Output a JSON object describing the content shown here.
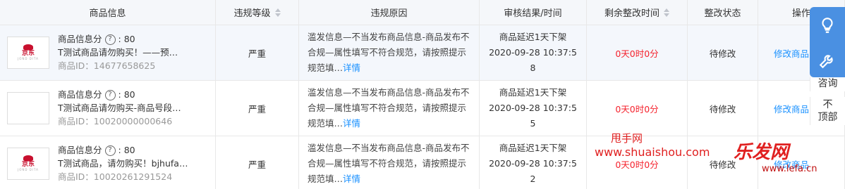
{
  "headers": {
    "product_info": "商品信息",
    "violation_level": "违规等级",
    "violation_reason": "违规原因",
    "audit_result": "审核结果/时间",
    "remaining_time": "剩余整改时间",
    "rectify_status": "整改状态",
    "action": "操作"
  },
  "rows": [
    {
      "score_label": "商品信息分",
      "score_value": "80",
      "name": "T测试商品请勿购买！——预…",
      "id": "商品ID：14677658625",
      "thumb_text": "京东",
      "thumb_sub": "JOND DITA",
      "level": "严重",
      "reason": "滥发信息—不当发布商品信息-商品发布不合规—属性填写不符合规范，请按照提示规范填…",
      "reason_link": "详情",
      "audit_line1": "商品延迟1天下架",
      "audit_line2": "2020-09-28 10:37:5",
      "audit_line3": "8",
      "remaining": "0天0时0分",
      "status": "待修改",
      "action": "修改商品"
    },
    {
      "score_label": "商品信息分",
      "score_value": "80",
      "name": "T测试商品请勿购买-商品号段…",
      "id": "商品ID：10020000000646",
      "thumb_text": "",
      "thumb_sub": "",
      "level": "严重",
      "reason": "滥发信息—不当发布商品信息-商品发布不合规—属性填写不符合规范，请按照提示规范填…",
      "reason_link": "详情",
      "audit_line1": "商品延迟1天下架",
      "audit_line2": "2020-09-28 10:37:5",
      "audit_line3": "5",
      "remaining": "0天0时0分",
      "status": "待修改",
      "action": "修改商品"
    },
    {
      "score_label": "商品信息分",
      "score_value": "80",
      "name": "T测试商品，请勿购买！bjhufa…",
      "id": "商品ID：10020261291524",
      "thumb_text": "京东",
      "thumb_sub": "JOND DITA",
      "level": "严重",
      "reason": "滥发信息—不当发布商品信息-商品发布不合规—属性填写不符合规范，请按照提示规范填…",
      "reason_link": "详情",
      "audit_line1": "商品延迟1天下架",
      "audit_line2": "2020-09-28 10:37:5",
      "audit_line3": "2",
      "remaining": "0天0时0分",
      "status": "待修改",
      "action": "修改商品"
    }
  ],
  "side": {
    "consult": "咨询",
    "top_line1": "不",
    "top_line2": "顶部"
  },
  "watermark": {
    "name": "甩手网",
    "url": "www.shuaishou.com",
    "brand": "乐发网",
    "brand_url": "www.lefa.cn"
  },
  "colors": {
    "link": "#1890ff",
    "danger": "#f5222d",
    "side_panel": "#4a90e2",
    "row_highlight": "#f4f7fc"
  },
  "icons": [
    "question-circle-icon",
    "sort-icon",
    "lightbulb-icon",
    "wrench-icon"
  ]
}
